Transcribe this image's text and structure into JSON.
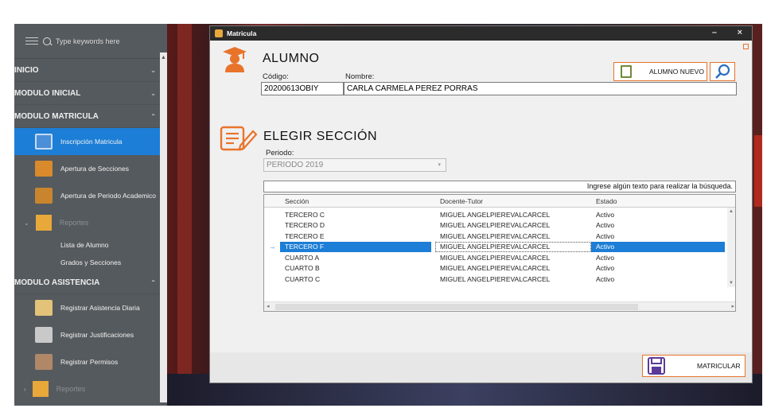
{
  "sidebar": {
    "search_placeholder": "Type keywords here",
    "sections": {
      "inicio": "INICIO",
      "modulo_inicial": "MODULO INICIAL",
      "modulo_matricula": "MODULO MATRICULA",
      "modulo_asistencia": "MODULO ASISTENCIA"
    },
    "matricula_items": [
      "Inscripción Matricula",
      "Apertura de Secciones",
      "Apertura de Periodo Academico"
    ],
    "reportes_label": "Reportes",
    "reportes_sub": [
      "Lista de Alumno",
      "Grados y Secciones"
    ],
    "asistencia_items": [
      "Registrar Asistencia Diaria",
      "Registrar Justificaciones",
      "Registrar Permisos"
    ],
    "reportes_label_2": "Reportes"
  },
  "dialog": {
    "title": "Matricula",
    "minimize_glyph": "–",
    "close_glyph": "×",
    "alumno": {
      "heading": "ALUMNO",
      "codigo_label": "Código:",
      "codigo_value": "20200613OBIY",
      "nombre_label": "Nombre:",
      "nombre_value": "CARLA CARMELA PEREZ PORRAS",
      "new_button": "ALUMNO NUEVO"
    },
    "seccion": {
      "heading": "ELEGIR SECCIÓN",
      "periodo_label": "Periodo:",
      "periodo_value": "PERIODO 2019",
      "search_hint": "Ingrese algún texto para realizar la búsqueda.",
      "columns": [
        "Sección",
        "Docente-Tutor",
        "Estado"
      ],
      "rows": [
        [
          "TERCERO C",
          "MIGUEL ANGELPIEREVALCARCEL",
          "Activo"
        ],
        [
          "TERCERO D",
          "MIGUEL ANGELPIEREVALCARCEL",
          "Activo"
        ],
        [
          "TERCERO E",
          "MIGUEL ANGELPIEREVALCARCEL",
          "Activo"
        ],
        [
          "TERCERO F",
          "MIGUEL ANGELPIEREVALCARCEL",
          "Activo"
        ],
        [
          "CUARTO A",
          "MIGUEL ANGELPIEREVALCARCEL",
          "Activo"
        ],
        [
          "CUARTO B",
          "MIGUEL ANGELPIEREVALCARCEL",
          "Activo"
        ],
        [
          "CUARTO C",
          "MIGUEL ANGELPIEREVALCARCEL",
          "Activo"
        ]
      ],
      "selected_row_index": 3,
      "row_pointer_glyph": "→"
    },
    "matricular_button": "MATRICULAR"
  },
  "colors": {
    "accent_orange": "#e8742c",
    "selection_blue": "#1c7ed6",
    "sidebar_bg": "#555a5e"
  }
}
